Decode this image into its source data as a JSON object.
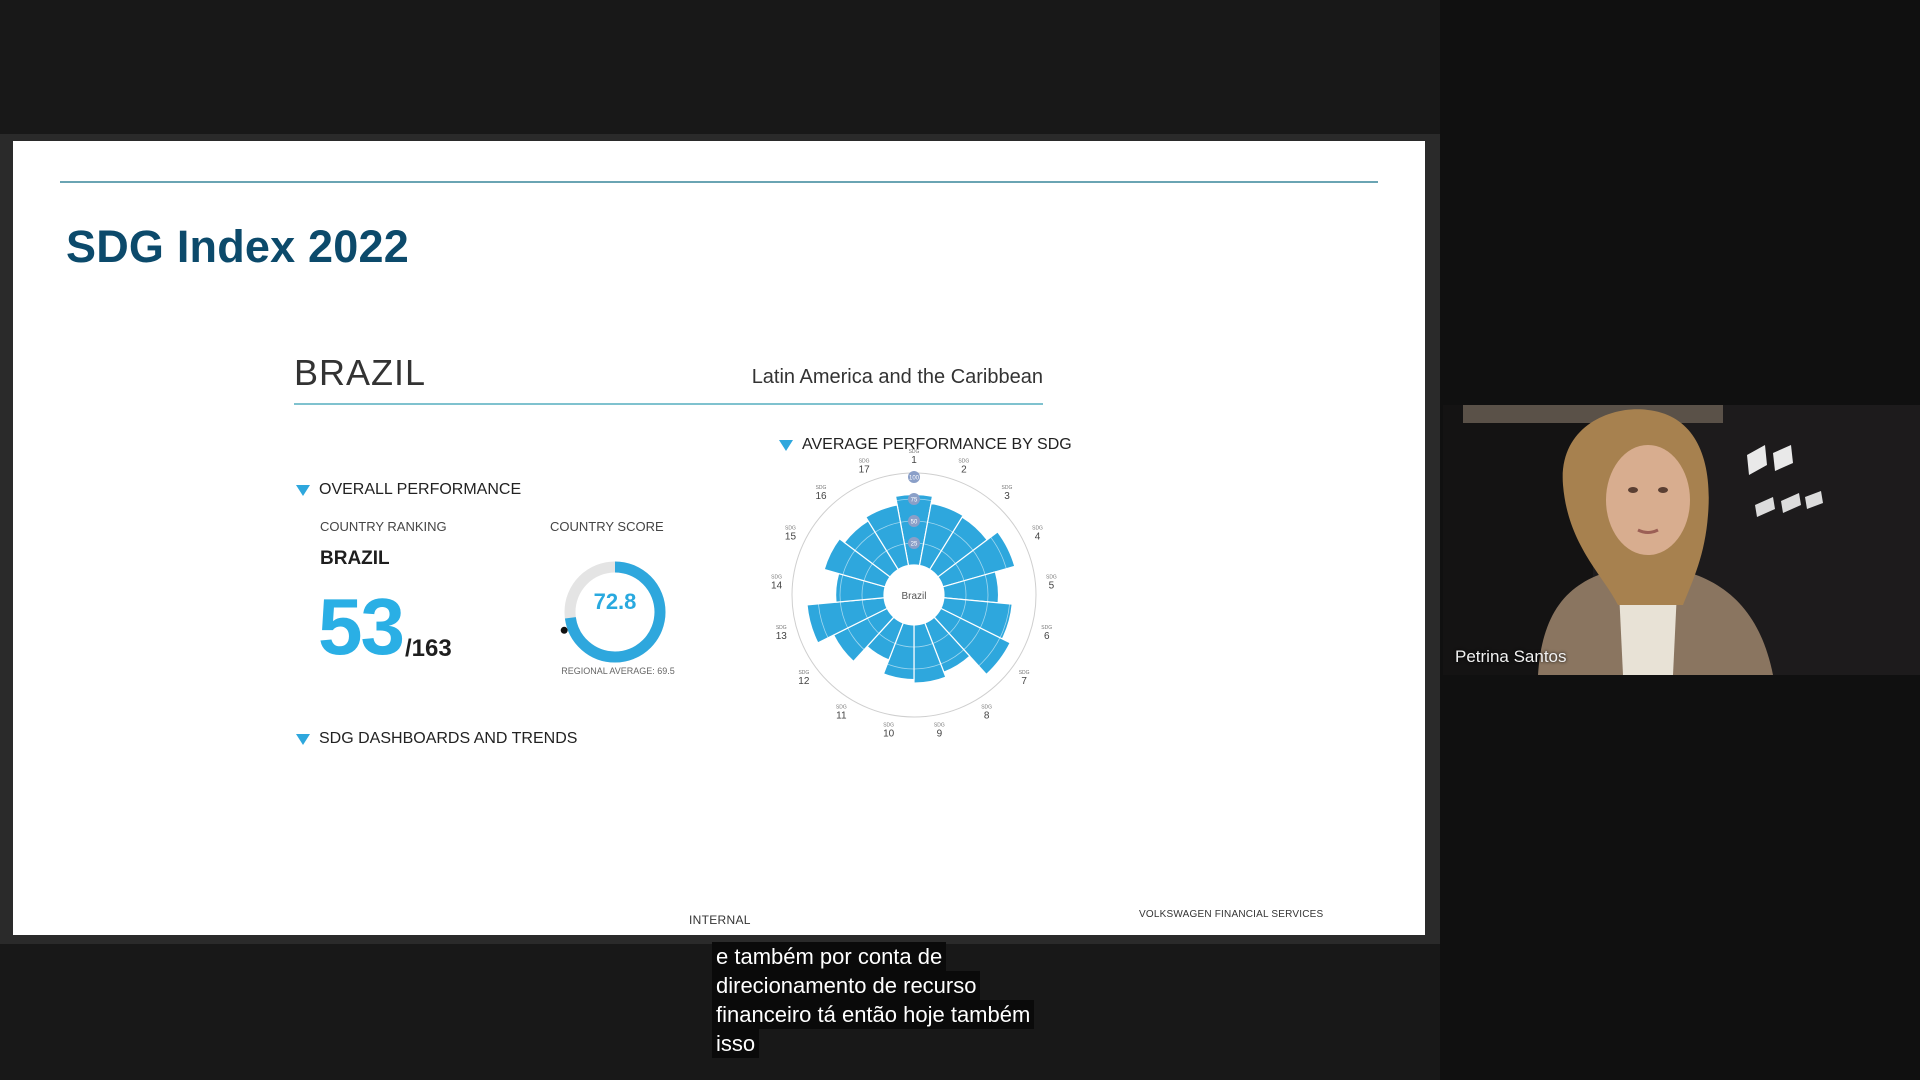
{
  "slide": {
    "title": "SDG Index 2022",
    "country_name": "BRAZIL",
    "region": "Latin America and the Caribbean",
    "overall_performance_label": "OVERALL PERFORMANCE",
    "country_ranking_label": "COUNTRY RANKING",
    "ranking_country": "BRAZIL",
    "rank": "53",
    "rank_total": "/163",
    "country_score_label": "COUNTRY SCORE",
    "country_score": "72.8",
    "country_score_value": 72.8,
    "regional_average_label": "REGIONAL AVERAGE: 69.5",
    "regional_average_value": 69.5,
    "average_performance_label": "AVERAGE PERFORMANCE BY SDG",
    "dashboards_label": "SDG DASHBOARDS AND TRENDS",
    "footer_internal": "INTERNAL",
    "footer_brand": "VOLKSWAGEN FINANCIAL SERVICES"
  },
  "radial_chart": {
    "center_label": "Brazil",
    "sdg_prefix": "SDG",
    "ring_labels": [
      "100",
      "75",
      "50",
      "25"
    ],
    "goals": [
      "1",
      "2",
      "3",
      "4",
      "5",
      "6",
      "7",
      "8",
      "9",
      "10",
      "11",
      "12",
      "13",
      "14",
      "15",
      "16",
      "17"
    ],
    "values": [
      80,
      72,
      70,
      85,
      62,
      78,
      88,
      60,
      66,
      62,
      45,
      68,
      88,
      55,
      72,
      65,
      70
    ],
    "color": "#2ea7dd"
  },
  "webcam": {
    "participant_name": "Petrina Santos"
  },
  "captions": [
    "e também por conta de",
    "direcionamento de recurso",
    "financeiro tá então hoje também",
    "isso"
  ],
  "colors": {
    "accent": "#2ea7dd",
    "title": "#0c4a6b"
  }
}
